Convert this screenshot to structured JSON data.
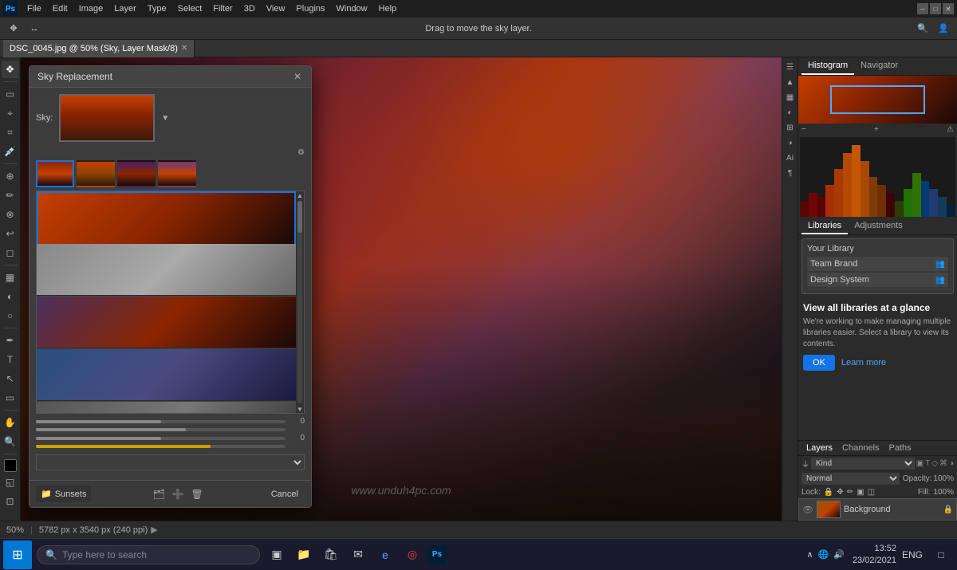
{
  "app": {
    "title": "Adobe Photoshop",
    "menu_items": [
      "File",
      "Edit",
      "Image",
      "Layer",
      "Type",
      "Select",
      "Filter",
      "3D",
      "View",
      "Plugins",
      "Window",
      "Help"
    ],
    "toolbar_hint": "Drag to move the sky layer.",
    "tab_name": "DSC_0045.jpg @ 50% (Sky, Layer Mask/8)",
    "zoom": "50%",
    "dimensions": "5782 px x 3540 px (240 ppi)",
    "date": "23/02/2021",
    "time": "13:52"
  },
  "dialog": {
    "title": "Sky Replacement",
    "sky_label": "Sky:",
    "cancel_label": "Cancel",
    "gear_icon": "⚙",
    "sky_list": [
      {
        "id": 1,
        "type": "sunset1",
        "selected": true
      },
      {
        "id": 2,
        "type": "sunset2",
        "selected": false
      },
      {
        "id": 3,
        "type": "sunset3",
        "selected": false
      },
      {
        "id": 4,
        "type": "sunset4",
        "selected": false
      },
      {
        "id": 5,
        "type": "sunset5",
        "selected": false
      }
    ],
    "sliders": [
      {
        "label": "",
        "value": "0",
        "fill_pct": 50,
        "type": "normal"
      },
      {
        "label": "",
        "value": "",
        "fill_pct": 60,
        "type": "normal"
      },
      {
        "label": "",
        "value": "0",
        "fill_pct": 50,
        "type": "normal"
      },
      {
        "label": "",
        "value": "",
        "fill_pct": 70,
        "type": "yellow"
      }
    ],
    "dropdown_value": "",
    "category": {
      "name": "Sunsets",
      "icon": "📁"
    },
    "footer_icons": [
      "🗂",
      "➕",
      "🗑"
    ]
  },
  "panels": {
    "histogram_tab": "Histogram",
    "navigator_tab": "Navigator",
    "libraries_tab": "Libraries",
    "adjustments_tab": "Adjustments",
    "layers_tab": "Layers",
    "channels_tab": "Channels",
    "paths_tab": "Paths",
    "layer_name": "Background",
    "blend_mode": "Normal",
    "opacity_label": "Opacity:",
    "opacity_value": "100%",
    "fill_label": "Fill:",
    "fill_value": "100%",
    "lock_label": "Lock:",
    "kind_label": "Kind",
    "lib_title": "Your Library",
    "lib_item1": "Team Brand",
    "lib_item2": "Design System",
    "lib_message_title": "View all libraries at a glance",
    "lib_message_body": "We're working to make managing multiple libraries easier. Select a library to view its contents.",
    "lib_ok": "OK",
    "lib_learn": "Learn more"
  },
  "taskbar": {
    "search_placeholder": "Type here to search",
    "time": "13:52",
    "date": "23/02/2021",
    "lang": "ENG"
  },
  "watermark": "www.unduh4pc.com",
  "status": {
    "zoom": "50%",
    "size_info": "5782 px x 3540 px (240 ppi)"
  }
}
